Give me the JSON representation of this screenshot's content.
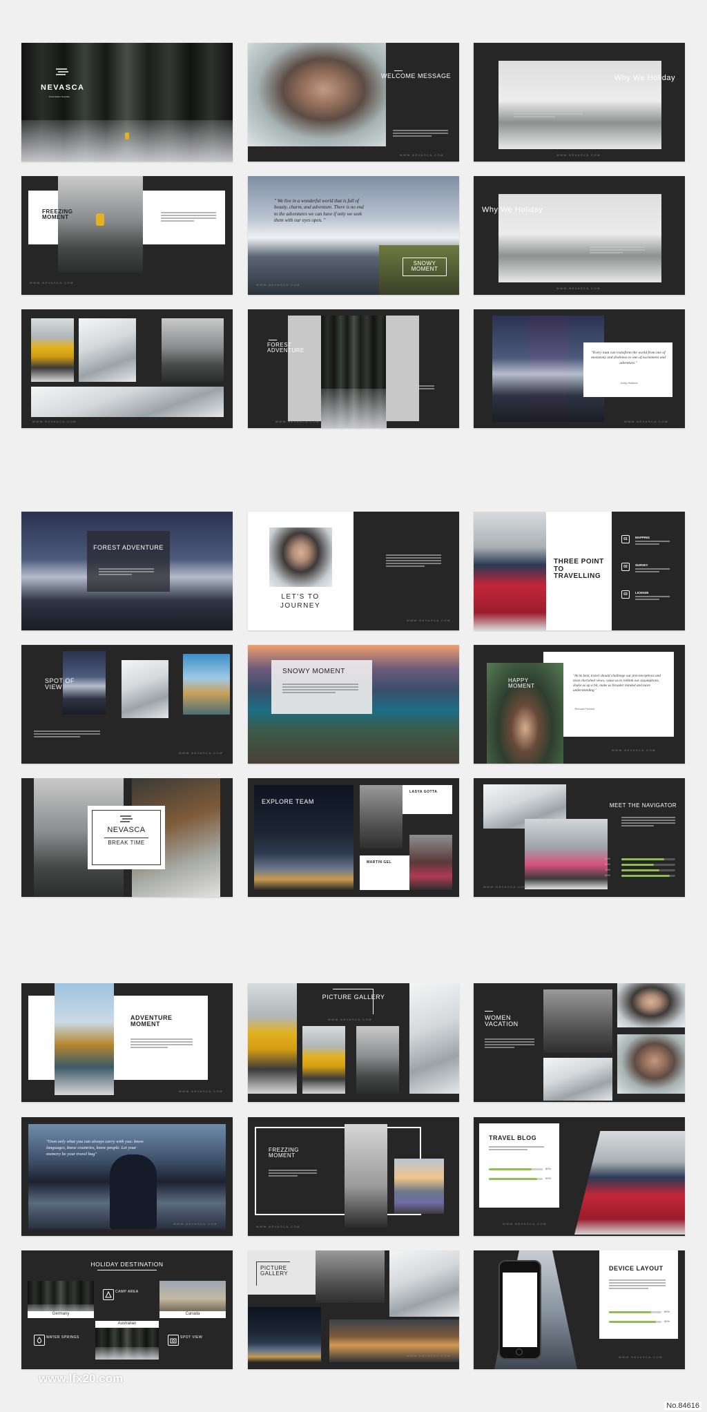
{
  "section1": {
    "s1_brand": "NEVASCA",
    "s1_sub": "Presentation Template",
    "s2_title": "WELCOME MESSAGE",
    "s3_title": "Why We Holiday",
    "s4_title": "FREEZING MOMENT",
    "s5_quote": "\" We live in a wonderful world that is full of beauty, charm, and adventure. There is no end to the adventures we can have if only we seek them with our eyes open. \"",
    "s5_label": "SNOWY MOMENT",
    "s6_title": "Why We Holiday",
    "s8_title": "FOREST ADVENTURE",
    "s9_quote": "\"Every man can transform the world from one of monotony and drabness to one of excitement and adventure.\"",
    "s9_author": "- Irving Wallace"
  },
  "section2": {
    "s1_title": "FOREST ADVENTURE",
    "s2_title": "LET'S TO JOURNEY",
    "s3_title": "THREE POINT TO TRAVELLING",
    "s3_items": [
      {
        "num": "01",
        "label": "MAPPING"
      },
      {
        "num": "02",
        "label": "SURVEY"
      },
      {
        "num": "03",
        "label": "LICENSE"
      }
    ],
    "s4_title": "SPOT OF VIEW",
    "s5_title": "SNOWY MOMENT",
    "s6_title": "HAPPY MOMENT",
    "s6_quote": "\"At its best, travel should challenge our preconceptions and most cherished views, cause us to rethink our assumptions, shake us up a bit, make us broader minded and more understanding.\"",
    "s6_author": "- Richard Ferraris",
    "s7_brand": "NEVASCA",
    "s7_title": "BREAK TIME",
    "s8_title": "EXPLORE TEAM",
    "s8_m1": "LASYA GOTTA",
    "s8_m2": "MARTIN GEL",
    "s9_title": "MEET THE NAVIGATOR",
    "s9_skills": [
      {
        "pct": "80%",
        "value": 0.8
      },
      {
        "pct": "60%",
        "value": 0.6
      },
      {
        "pct": "70%",
        "value": 0.7
      },
      {
        "pct": "90%",
        "value": 0.9
      }
    ]
  },
  "section3": {
    "s1_title": "ADVENTURE MOMENT",
    "s2_title": "PICTURE GALLERY",
    "s3_title": "WOMEN VACATION",
    "s4_quote": "\"Own only what you can always carry with you: know languages, know countries, know people. Let your memory be your travel bag\"",
    "s5_title": "FREZZING MOMENT",
    "s6_title": "TRAVEL BLOG",
    "s6_bars": [
      {
        "pct": "80%",
        "value": 0.8
      },
      {
        "pct": "90%",
        "value": 0.9
      }
    ],
    "s7_title": "HOLIDAY DESTINATION",
    "s7_places": [
      "Germany",
      "Australian",
      "Canada"
    ],
    "s7_features": [
      "CAMP AREA",
      "WATER SPRINGS",
      "SPOT VIEW"
    ],
    "s8_title": "PICTURE GALLERY",
    "s9_title": "DEVICE LAYOUT",
    "s9_bars": [
      {
        "pct": "80%",
        "value": 0.8
      },
      {
        "pct": "90%",
        "value": 0.9
      }
    ]
  },
  "footer_url": "WWW.NEVASCA.COM",
  "watermark": "www.lfx20.com",
  "catalog_number": "No.84616"
}
